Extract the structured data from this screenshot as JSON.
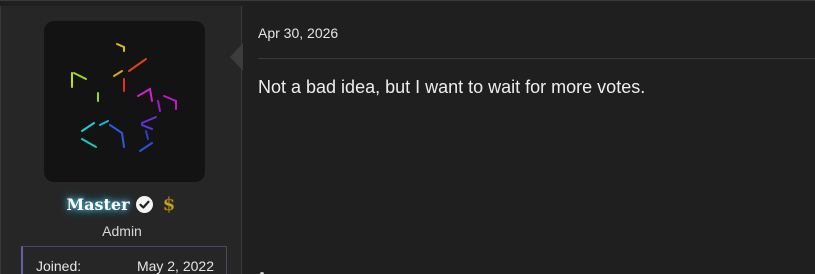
{
  "post": {
    "date": "Apr 30, 2026",
    "body": "Not a bad idea, but I want to wait for more votes."
  },
  "user": {
    "name": "Master",
    "title": "Admin",
    "badges": [
      "verified-check-icon",
      "dollar-coin-icon"
    ],
    "extras": {
      "joined_label": "Joined:",
      "joined_value": "May 2, 2022"
    }
  },
  "colors": {
    "background": "#1f1f1f",
    "user_panel": "#262626",
    "avatar_bg": "#131313",
    "username_glow": "#58c8e8",
    "text": "#eeeeee",
    "badge_gold": "#c9a227"
  }
}
